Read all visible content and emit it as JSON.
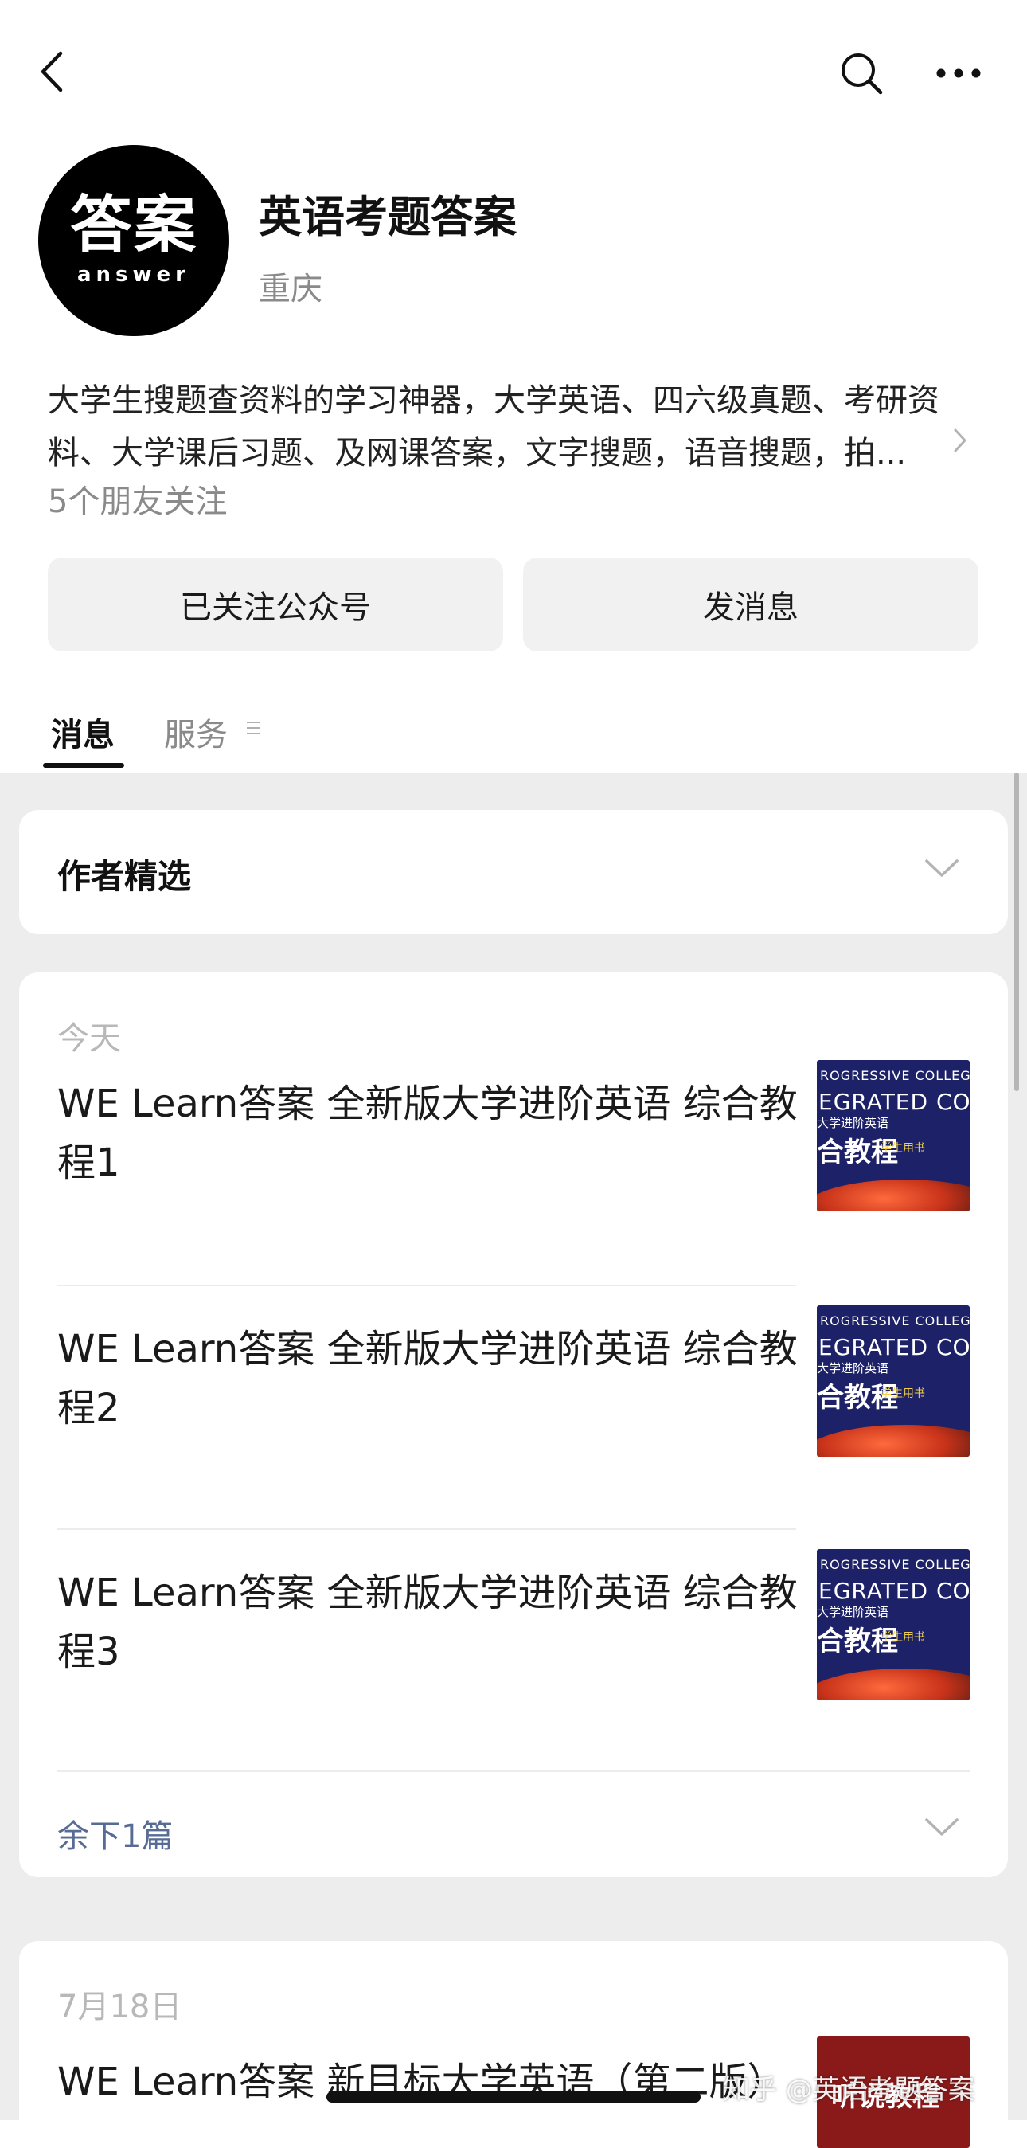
{
  "header": {
    "back_icon": "chevron-left-icon",
    "search_icon": "search-icon",
    "more_icon": "ellipsis-icon"
  },
  "account": {
    "avatar_text": "答案",
    "avatar_subtext": "answer",
    "name": "英语考题答案",
    "region": "重庆",
    "description": "大学生搜题查资料的学习神器，大学英语、四六级真题、考研资料、大学课后习题、及网课答案，文字搜题，语音搜题，拍...",
    "friends_following": "5个朋友关注"
  },
  "actions": {
    "follow_label": "已关注公众号",
    "message_label": "发消息"
  },
  "tabs": [
    {
      "label": "消息",
      "active": true
    },
    {
      "label": "服务",
      "active": false
    }
  ],
  "feed": {
    "picks_title": "作者精选",
    "today": {
      "label": "今天",
      "articles": [
        {
          "title": "WE Learn答案 全新版大学进阶英语 综合教程1"
        },
        {
          "title": "WE Learn答案 全新版大学进阶英语 综合教程2"
        },
        {
          "title": "WE Learn答案 全新版大学进阶英语 综合教程3"
        }
      ],
      "thumb": {
        "line1": "ROGRESSIVE COLLEGE ENG",
        "line2": "EGRATED COUR",
        "line3": "大学进阶英语",
        "line4": "合教程",
        "line5": "学生用书"
      },
      "remaining": "余下1篇"
    },
    "older": {
      "label": "7月18日",
      "title": "WE Learn答案 新目标大学英语（第二版）",
      "thumb_text": "听说教程"
    }
  },
  "watermark": "知乎 @英语考题答案",
  "colors": {
    "link": "#576b95",
    "feed_bg": "#ededed",
    "button_bg": "#f1f1f1"
  }
}
